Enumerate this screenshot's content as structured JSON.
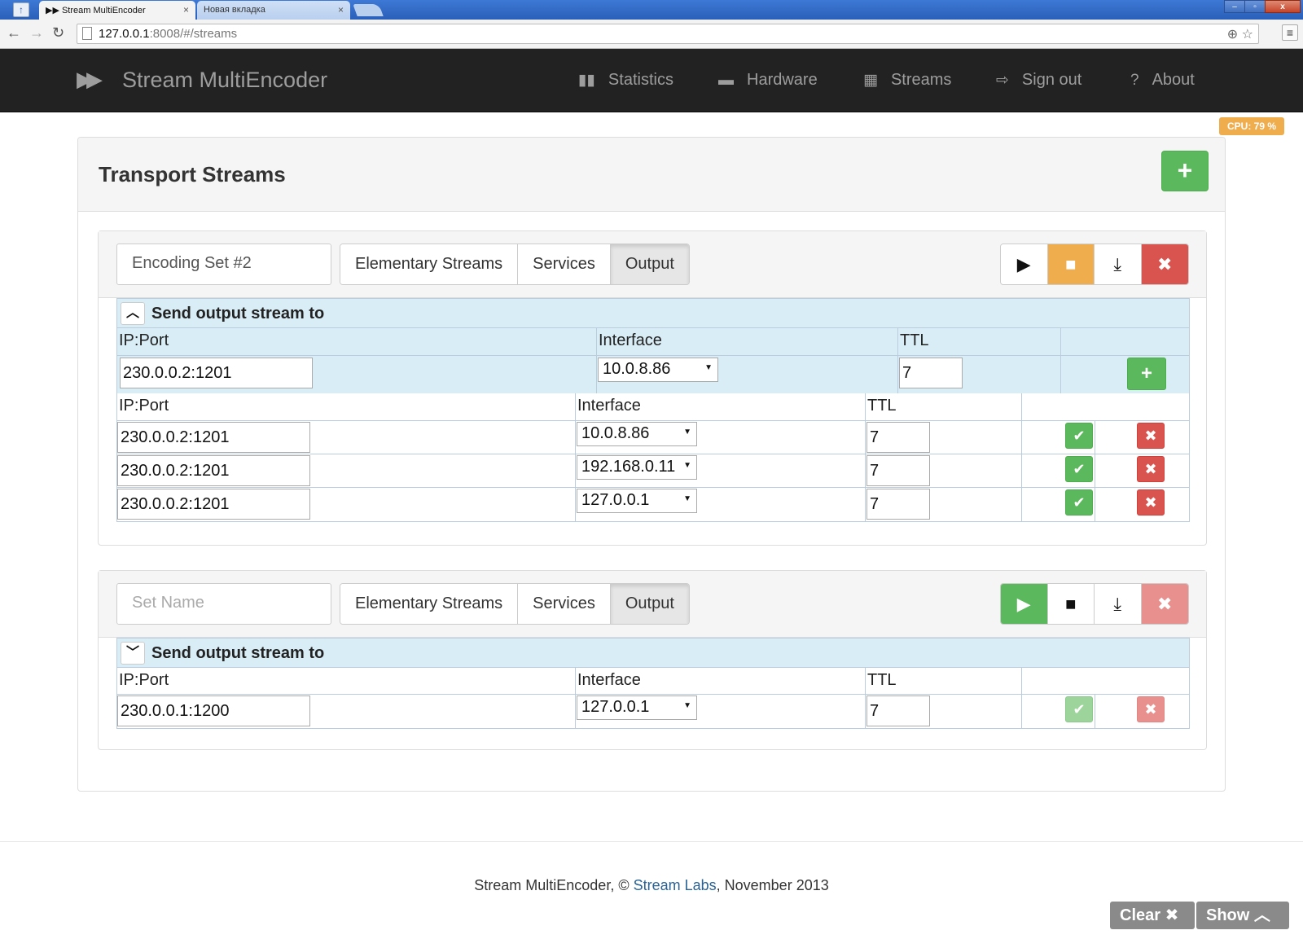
{
  "browser": {
    "tabs": [
      {
        "label": "▶▶ Stream MultiEncoder",
        "close": "×"
      },
      {
        "label": "Новая вкладка",
        "close": "×"
      }
    ],
    "url_host": "127.0.0.1",
    "url_path": ":8008/#/streams"
  },
  "navbar": {
    "brand": "Stream MultiEncoder",
    "items": [
      {
        "label": "Statistics",
        "icon": "bar-chart-icon"
      },
      {
        "label": "Hardware",
        "icon": "hdd-icon"
      },
      {
        "label": "Streams",
        "icon": "film-icon"
      },
      {
        "label": "Sign out",
        "icon": "logout-icon"
      },
      {
        "label": "About",
        "icon": "question-icon"
      }
    ],
    "cpu": "CPU: 79 %"
  },
  "page": {
    "title": "Transport Streams"
  },
  "tabs": [
    "Elementary Streams",
    "Services",
    "Output"
  ],
  "output": {
    "title": "Send output stream to",
    "col_ip": "IP:Port",
    "col_iface": "Interface",
    "col_ttl": "TTL"
  },
  "sets": [
    {
      "name": "Encoding Set #2",
      "new_row": {
        "ip": "230.0.0.2:1201",
        "iface": "10.0.8.86",
        "ttl": "7"
      },
      "rows": [
        {
          "ip": "230.0.0.2:1201",
          "iface": "10.0.8.86",
          "ttl": "7"
        },
        {
          "ip": "230.0.0.2:1201",
          "iface": "192.168.0.11",
          "ttl": "7"
        },
        {
          "ip": "230.0.0.2:1201",
          "iface": "127.0.0.1",
          "ttl": "7"
        }
      ]
    },
    {
      "name_placeholder": "Set Name",
      "rows": [
        {
          "ip": "230.0.0.1:1200",
          "iface": "127.0.0.1",
          "ttl": "7"
        }
      ]
    }
  ],
  "footer": {
    "prefix": "Stream MultiEncoder, © ",
    "link": "Stream Labs",
    "suffix": ", November 2013"
  },
  "debug": {
    "clear": "Clear",
    "show": "Show"
  },
  "colors": {
    "navbar_bg": "#222222",
    "success": "#5cb85c",
    "warning": "#f0ad4e",
    "danger": "#d9534f",
    "info_bg": "#d9edf7"
  }
}
